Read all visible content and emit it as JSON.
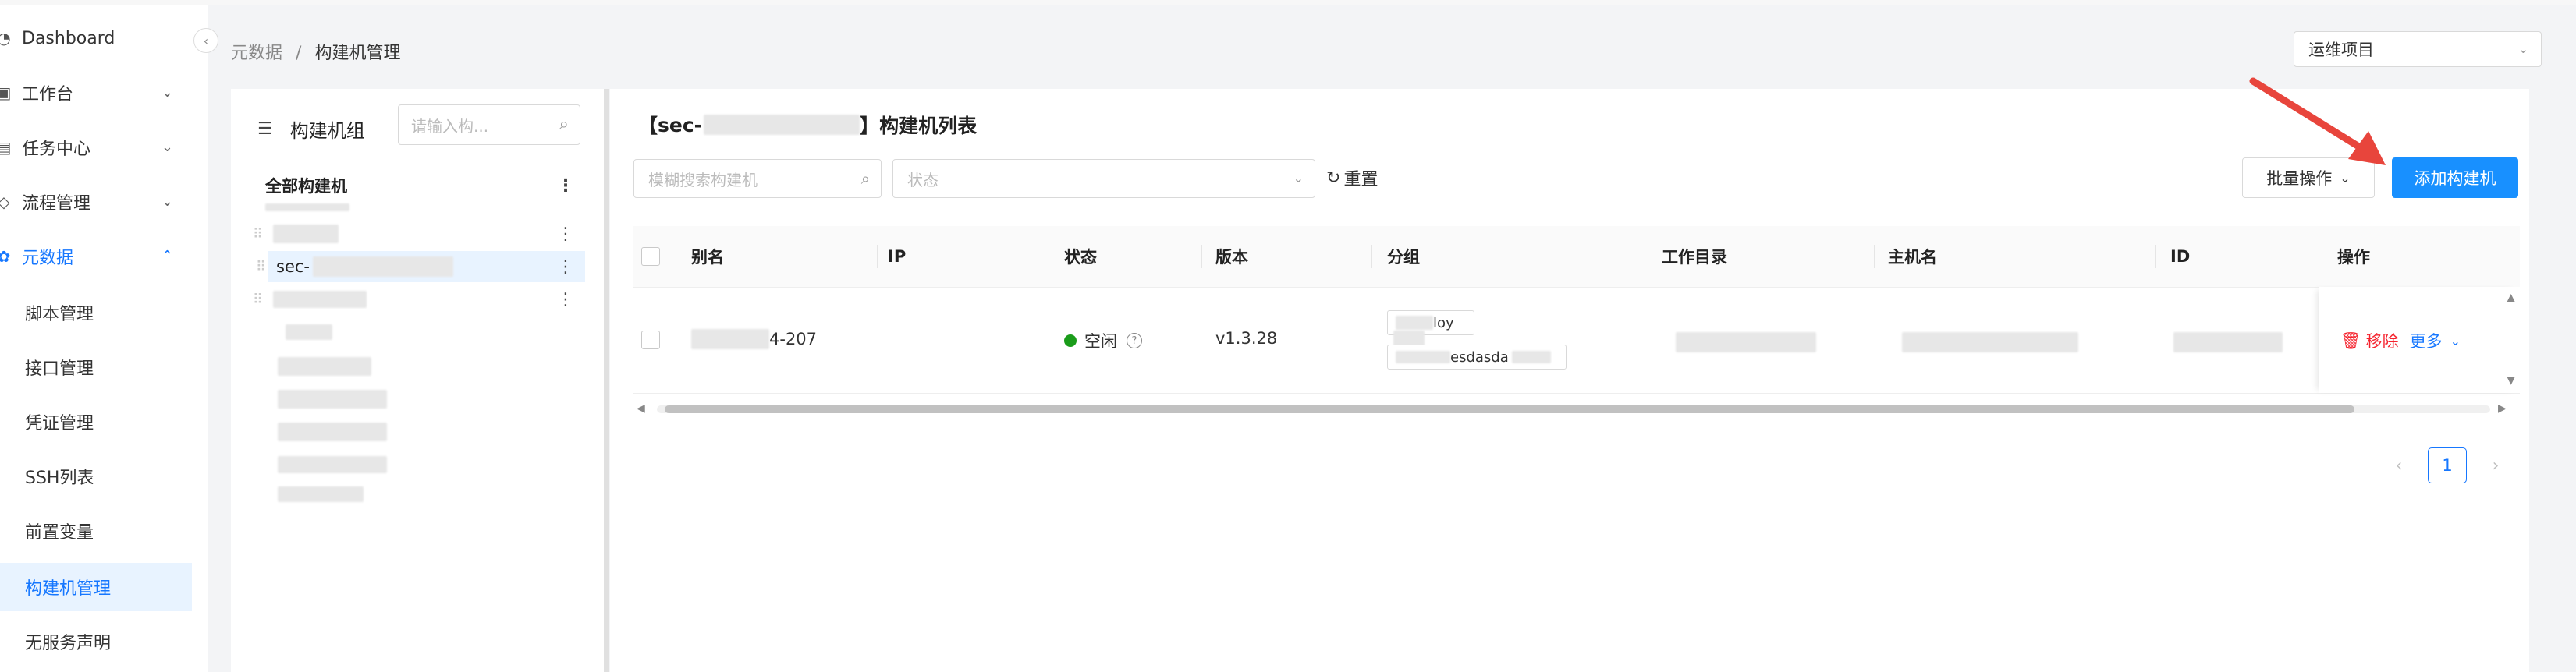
{
  "sidebar": {
    "items": [
      {
        "label": "Dashboard",
        "icon": "dashboard-icon"
      },
      {
        "label": "工作台",
        "icon": "workbench-icon"
      },
      {
        "label": "任务中心",
        "icon": "task-icon"
      },
      {
        "label": "流程管理",
        "icon": "flow-icon"
      },
      {
        "label": "元数据",
        "icon": "metadata-icon"
      }
    ],
    "sub_items": [
      "脚本管理",
      "接口管理",
      "凭证管理",
      "SSH列表",
      "前置变量",
      "构建机管理",
      "无服务声明"
    ]
  },
  "breadcrumb": {
    "parent": "元数据",
    "separator": "/",
    "current": "构建机管理"
  },
  "project_select": {
    "value": "运维项目"
  },
  "group_panel": {
    "title": "构建机组",
    "search_placeholder": "请输入构...",
    "all_label": "全部构建机",
    "selected_prefix": "sec-",
    "dots": "⋮"
  },
  "main": {
    "title_bracket_open": "【",
    "title_prefix": "sec-",
    "title_bracket_close": "】",
    "title_text": "构建机列表",
    "search_placeholder": "模糊搜索构建机",
    "status_placeholder": "状态",
    "reset_label": "重置",
    "batch_label": "批量操作",
    "add_label": "添加构建机"
  },
  "table": {
    "columns": [
      "别名",
      "IP",
      "状态",
      "版本",
      "分组",
      "工作目录",
      "主机名",
      "ID",
      "操作"
    ],
    "row": {
      "alias_suffix": "4-207",
      "status": "空闲",
      "version": "v1.3.28",
      "group_tag1": "loy",
      "group_tag2": "esdasda",
      "remove_label": "移除",
      "more_label": "更多"
    }
  },
  "pagination": {
    "current": "1"
  },
  "colors": {
    "primary": "#1890ff",
    "danger": "#f5222d",
    "success": "#1a9c1a",
    "annotation_arrow": "#e8453c"
  }
}
